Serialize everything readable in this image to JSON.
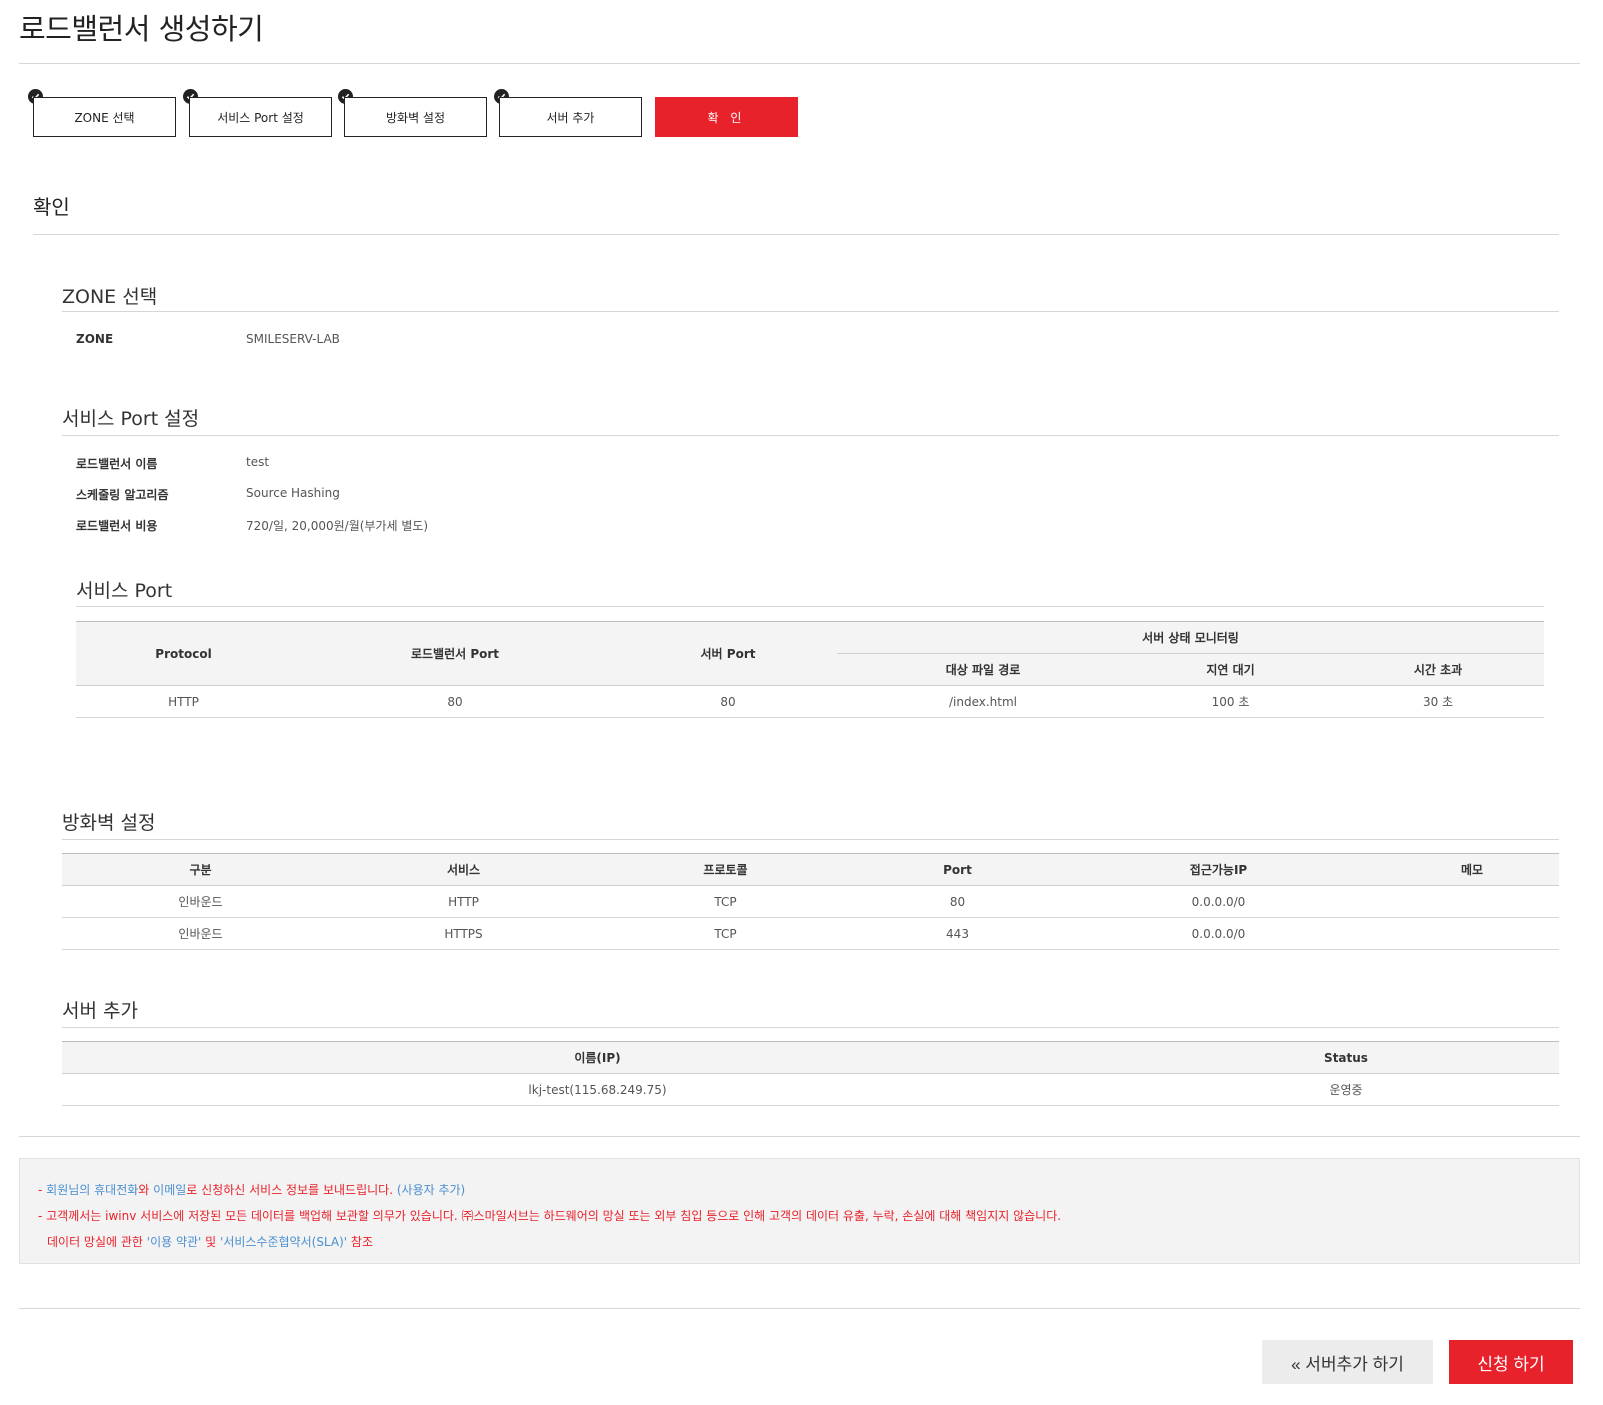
{
  "page_title": "로드밸런서 생성하기",
  "steps": [
    {
      "label": "ZONE 선택",
      "done": true
    },
    {
      "label": "서비스 Port 설정",
      "done": true
    },
    {
      "label": "방화벽 설정",
      "done": true
    },
    {
      "label": "서버 추가",
      "done": true
    },
    {
      "label": "확 인",
      "done": false,
      "active": true
    }
  ],
  "confirm_title": "확인",
  "zone_section": {
    "title": "ZONE 선택",
    "label": "ZONE",
    "value": "SMILESERV-LAB"
  },
  "service_port_section": {
    "title": "서비스 Port 설정",
    "rows": [
      {
        "label": "로드밸런서 이름",
        "value": "test"
      },
      {
        "label": "스케줄링 알고리즘",
        "value": "Source Hashing"
      },
      {
        "label": "로드밸런서 비용",
        "value": "720/일, 20,000원/월(부가세 별도)"
      }
    ]
  },
  "service_port_table": {
    "title": "서비스 Port",
    "headers": {
      "protocol": "Protocol",
      "lb_port": "로드밸런서 Port",
      "server_port": "서버 Port",
      "monitoring": "서버 상태 모니터링",
      "path": "대상 파일 경로",
      "delay": "지연 대기",
      "timeout": "시간 초과"
    },
    "rows": [
      {
        "protocol": "HTTP",
        "lb_port": "80",
        "server_port": "80",
        "path": "/index.html",
        "delay": "100 초",
        "timeout": "30 초"
      }
    ]
  },
  "firewall_section": {
    "title": "방화벽 설정",
    "headers": [
      "구분",
      "서비스",
      "프로토콜",
      "Port",
      "접근가능IP",
      "메모"
    ],
    "rows": [
      [
        "인바운드",
        "HTTP",
        "TCP",
        "80",
        "0.0.0.0/0",
        ""
      ],
      [
        "인바운드",
        "HTTPS",
        "TCP",
        "443",
        "0.0.0.0/0",
        ""
      ]
    ]
  },
  "server_section": {
    "title": "서버 추가",
    "headers": [
      "이름(IP)",
      "Status"
    ],
    "rows": [
      [
        "lkj-test(115.68.249.75)",
        "운영중"
      ]
    ]
  },
  "notice": {
    "line1_prefix": "- ",
    "line1_a": "회원님의 휴대전화",
    "line1_b": "와 ",
    "line1_c": "이메일",
    "line1_d": "로 신청하신 서비스 정보를 보내드립니다.",
    "line1_link": " (사용자 추가)",
    "line2": "- 고객께서는 iwinv 서비스에 저장된 모든 데이터를 백업해 보관할 의무가 있습니다. ㈜스마일서브는 하드웨어의 망실 또는 외부 침입 등으로 인해 고객의 데이터 유출, 누락, 손실에 대해 책임지지 않습니다.",
    "line3_a": "데이터 망실에 관한 ",
    "line3_b": "'이용 약관'",
    "line3_c": " 및 ",
    "line3_d": "'서비스수준협약서(SLA)'",
    "line3_e": " 참조"
  },
  "buttons": {
    "back": "« 서버추가 하기",
    "apply": "신청 하기"
  },
  "colors": {
    "accent": "#e8222b",
    "link": "#4a8fd0"
  }
}
